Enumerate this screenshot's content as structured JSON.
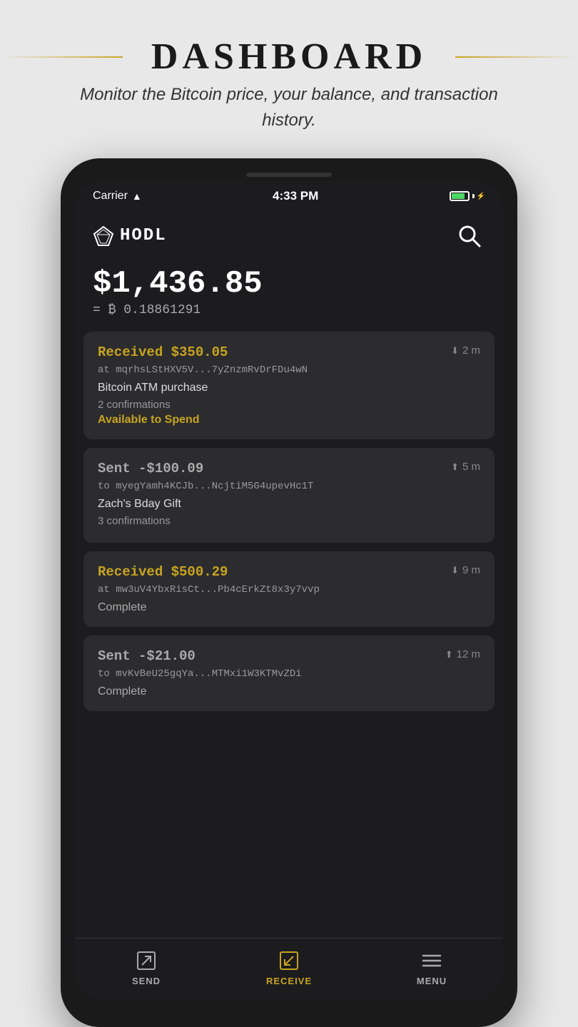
{
  "page": {
    "title": "DASHBOARD",
    "subtitle": "Monitor the Bitcoin price, your balance, and transaction history."
  },
  "status_bar": {
    "carrier": "Carrier",
    "time": "4:33 PM"
  },
  "app": {
    "logo_text": "HODL",
    "balance_usd": "$1,436.85",
    "balance_btc_prefix": "= ₿",
    "balance_btc_value": "0.18861291"
  },
  "transactions": [
    {
      "id": "tx1",
      "type": "received",
      "amount": "Received $350.05",
      "address": "at mqrhsLStHXV5V...7yZnzmRvDrFDu4wN",
      "time": "2 m",
      "label": "Bitcoin ATM purchase",
      "confirmations": "2 confirmations",
      "status": "Available to Spend",
      "status_type": "available"
    },
    {
      "id": "tx2",
      "type": "sent",
      "amount": "Sent -$100.09",
      "address": "to myegYamh4KCJb...NcjtiM5G4upevHc1T",
      "time": "5 m",
      "label": "Zach's Bday Gift",
      "confirmations": "3 confirmations",
      "status": "",
      "status_type": "none"
    },
    {
      "id": "tx3",
      "type": "received",
      "amount": "Received $500.29",
      "address": "at mw3uV4YbxRisCt...Pb4cErkZt8x3y7vvp",
      "time": "9 m",
      "label": "",
      "confirmations": "",
      "status": "Complete",
      "status_type": "complete"
    },
    {
      "id": "tx4",
      "type": "sent",
      "amount": "Sent -$21.00",
      "address": "to mvKvBeU25gqYa...MTMxi1W3KTMvZDi",
      "time": "12 m",
      "label": "",
      "confirmations": "",
      "status": "Complete",
      "status_type": "complete"
    }
  ],
  "nav": {
    "send_label": "SEND",
    "receive_label": "RECEIVE",
    "menu_label": "MENU"
  }
}
